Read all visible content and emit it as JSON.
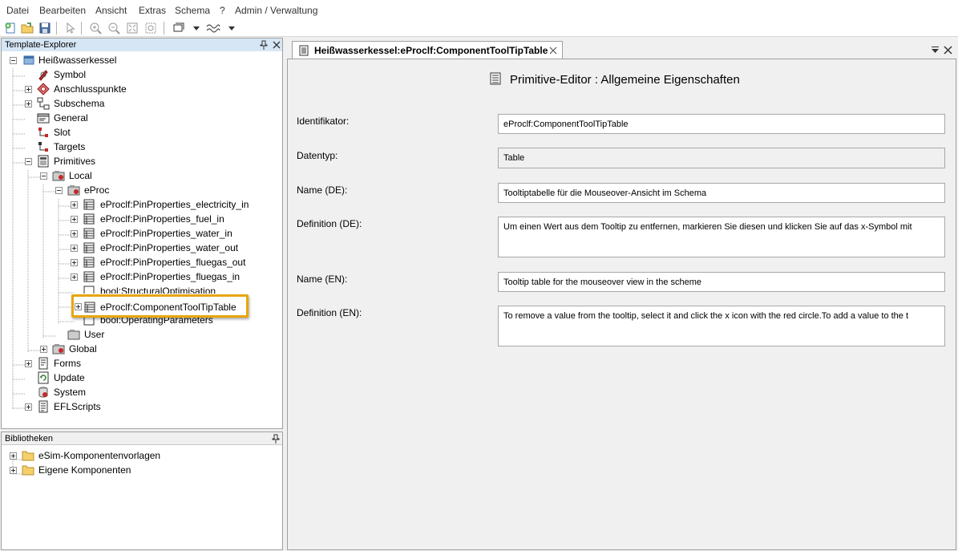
{
  "menubar": {
    "items": [
      "Datei",
      "Bearbeiten",
      "Ansicht",
      "Extras",
      "Schema",
      "?",
      "Admin / Verwaltung"
    ]
  },
  "toolbar": {
    "icons": [
      "new-icon",
      "open-icon",
      "save-icon",
      "zoom-in-icon",
      "zoom-out-icon",
      "zoom-fit-icon",
      "zoom-window-icon",
      "pointer-icon",
      "layout-icon",
      "connector-icon"
    ]
  },
  "explorer": {
    "title": "Template-Explorer",
    "tree": {
      "root": "Heißwasserkessel",
      "symbol": "Symbol",
      "anschluss": "Anschlusspunkte",
      "subschema": "Subschema",
      "general": "General",
      "slot": "Slot",
      "targets": "Targets",
      "primitives": "Primitives",
      "local": "Local",
      "eproc": "eProc",
      "items": [
        "eProclf:PinProperties_electricity_in",
        "eProclf:PinProperties_fuel_in",
        "eProclf:PinProperties_water_in",
        "eProclf:PinProperties_water_out",
        "eProclf:PinProperties_fluegas_out",
        "eProclf:PinProperties_fluegas_in",
        "bool:StructuralOptimisation",
        "eProclf:ComponentToolTipTable",
        "bool:OperatingParameters"
      ],
      "user": "User",
      "global": "Global",
      "forms": "Forms",
      "update": "Update",
      "system": "System",
      "eflscripts": "EFLScripts"
    }
  },
  "libraries": {
    "title": "Bibliotheken",
    "items": [
      "eSim-Komponentenvorlagen",
      "Eigene Komponenten"
    ]
  },
  "editor": {
    "tab_title": "Heißwasserkessel:eProclf:ComponentToolTipTable",
    "heading": "Primitive-Editor : Allgemeine Eigenschaften",
    "fields": {
      "identifikator": {
        "label": "Identifikator:",
        "value": "eProclf:ComponentToolTipTable"
      },
      "datentyp": {
        "label": "Datentyp:",
        "value": "Table"
      },
      "name_de": {
        "label": "Name (DE):",
        "value": "Tooltiptabelle für die Mouseover-Ansicht im Schema"
      },
      "definition_de": {
        "label": "Definition (DE):",
        "value": "Um einen Wert aus dem Tooltip zu entfernen, markieren Sie diesen und klicken Sie auf das x-Symbol mit"
      },
      "name_en": {
        "label": "Name (EN):",
        "value": "Tooltip table for the mouseover view in the scheme"
      },
      "definition_en": {
        "label": "Definition (EN):",
        "value": "To remove a value from the tooltip, select it and click the x icon with the red circle.To add a value to the t"
      }
    }
  },
  "colors": {
    "highlight": "#e8a60c",
    "explorer_title_bg": "#d6e6f5",
    "folder": "#f5cf6a"
  }
}
